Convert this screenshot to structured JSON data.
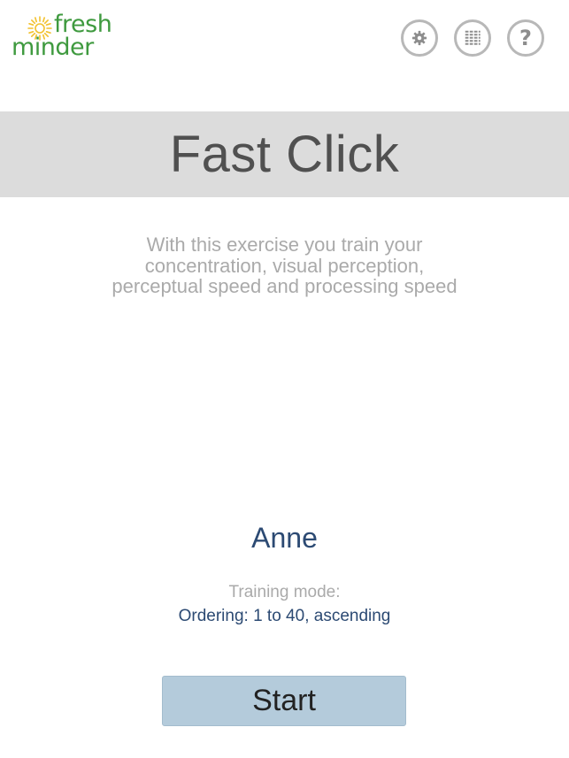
{
  "app": {
    "logo_top": "fresh",
    "logo_bottom": "minder",
    "logo_color": "#3f9a3f",
    "logo_sun_color": "#f2c12e"
  },
  "toolbar": {
    "icons": [
      "settings-icon",
      "statistics-icon",
      "help-icon"
    ],
    "help_glyph": "?"
  },
  "exercise": {
    "title": "Fast Click",
    "description_lines": [
      "With this exercise you train your",
      "concentration, visual perception,",
      "perceptual speed and processing speed"
    ]
  },
  "user": {
    "name": "Anne"
  },
  "training": {
    "mode_label": "Training mode:",
    "mode_value": "Ordering: 1 to 40, ascending"
  },
  "actions": {
    "start_label": "Start"
  },
  "colors": {
    "title_bar_bg": "#dcdcdc",
    "accent_text": "#2c4a73",
    "start_button_bg": "#b4cbdb",
    "muted_text": "#aaaaaa"
  }
}
